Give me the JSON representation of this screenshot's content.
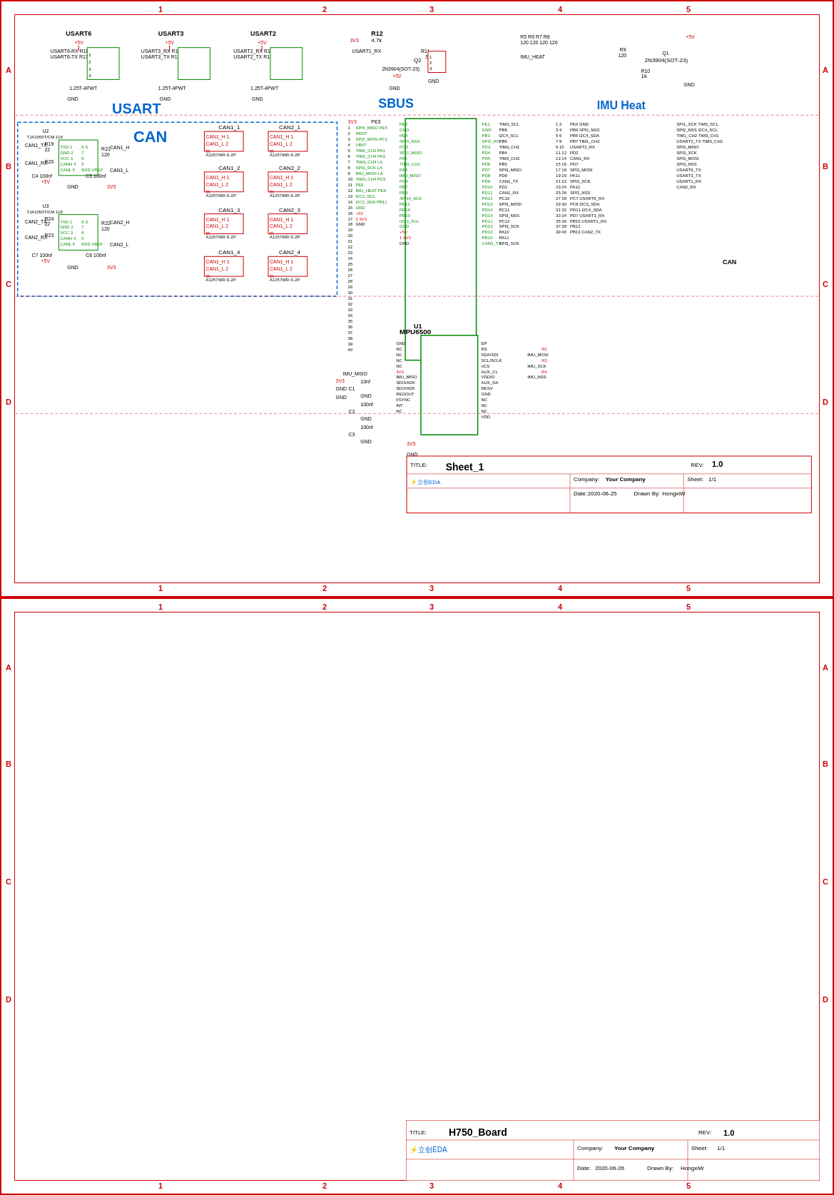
{
  "sheet1": {
    "title": "Sheet_1",
    "rev": "1.0",
    "company": "Your Company",
    "sheet": "1/1",
    "date": "2020-06-25",
    "drawn_by": "HongxiW"
  },
  "sheet2": {
    "title": "H750_Board",
    "rev": "1.0",
    "company": "Your Company",
    "sheet": "1/1",
    "date": "2020-06-26",
    "drawn_by": "HongxiW"
  },
  "sections": {
    "usart": "USART",
    "can": "CAN",
    "sbus": "SBUS",
    "imu_heat": "IMU Heat"
  },
  "row_labels": [
    "A",
    "B",
    "C",
    "D"
  ],
  "col_labels": [
    "1",
    "2",
    "3",
    "4",
    "5"
  ],
  "logo_text": "立创EDA"
}
